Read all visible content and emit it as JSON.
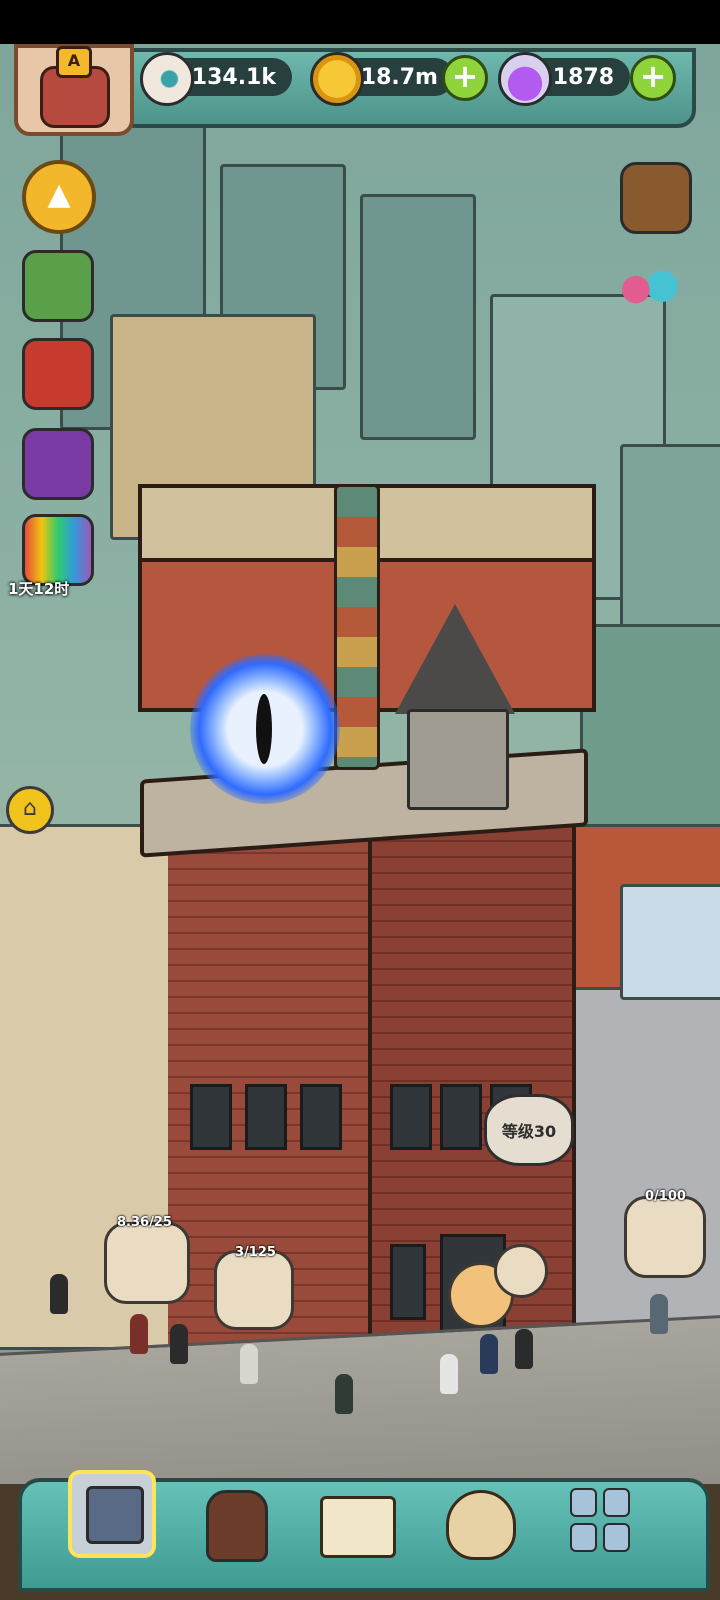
{
  "resources": {
    "eyes": "134.1k",
    "coins": "18.7m",
    "potions": "1878",
    "plus_symbol": "+"
  },
  "avatar": {
    "rank_letter": "A"
  },
  "side_menu": {
    "up_arrow": "▲",
    "timer_label": "1天12时",
    "home_symbol": "⌂"
  },
  "bubbles": {
    "food_1_count": "8.36/25",
    "food_2_count": "3/125",
    "storage_count": "0/100",
    "level_label": "等级30"
  },
  "bottom_nav": {
    "items": [
      "building",
      "totem",
      "book",
      "money-bag",
      "grid"
    ],
    "active": "building"
  },
  "colors": {
    "bar_teal": "#4d948b",
    "plus_green": "#8fd43a",
    "accent_yellow": "#f2b72a"
  }
}
